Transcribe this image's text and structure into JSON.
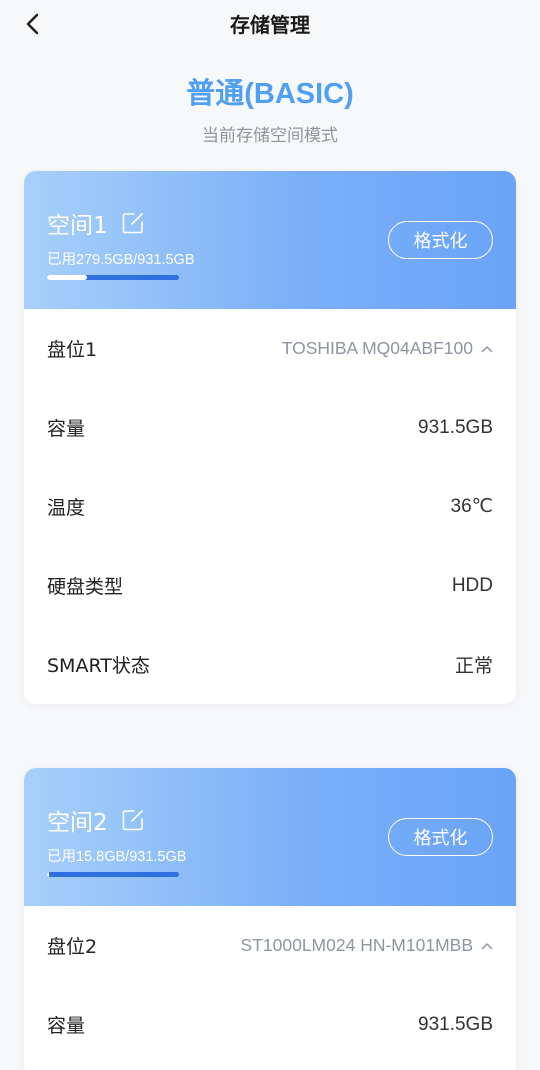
{
  "header": {
    "title": "存储管理"
  },
  "mode": {
    "title": "普通(BASIC)",
    "subtitle": "当前存储空间模式"
  },
  "spaces": [
    {
      "name": "空间1",
      "usage": "已用279.5GB/931.5GB",
      "usage_fraction": 0.3,
      "format_label": "格式化",
      "rows": [
        {
          "label": "盘位1",
          "value": "TOSHIBA MQ04ABF100"
        },
        {
          "label": "容量",
          "value": "931.5GB"
        },
        {
          "label": "温度",
          "value": "36℃"
        },
        {
          "label": "硬盘类型",
          "value": "HDD"
        },
        {
          "label": "SMART状态",
          "value": "正常"
        }
      ]
    },
    {
      "name": "空间2",
      "usage": "已用15.8GB/931.5GB",
      "usage_fraction": 0.017,
      "format_label": "格式化",
      "rows": [
        {
          "label": "盘位2",
          "value": "ST1000LM024 HN-M101MBB"
        },
        {
          "label": "容量",
          "value": "931.5GB"
        }
      ]
    }
  ],
  "icons": {
    "back": "chevron-left-icon",
    "edit": "edit-icon",
    "expand": "chevron-up-icon"
  },
  "colors": {
    "accent": "#4f9ff3",
    "gradient_start": "#a7cff9",
    "gradient_end": "#6aa3f7",
    "progress_track": "#2f6fe0"
  }
}
